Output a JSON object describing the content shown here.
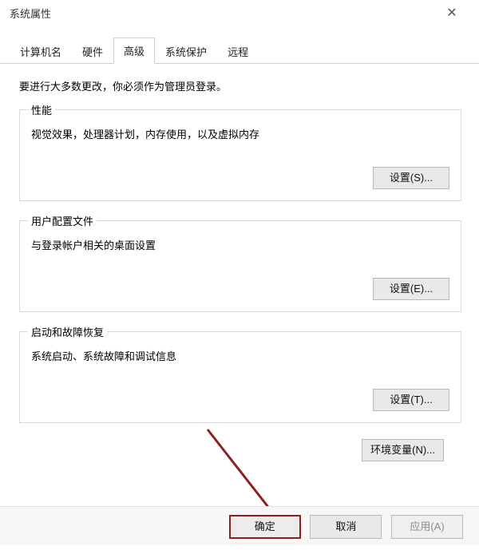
{
  "window": {
    "title": "系统属性"
  },
  "tabs": {
    "computer_name": "计算机名",
    "hardware": "硬件",
    "advanced": "高级",
    "system_protection": "系统保护",
    "remote": "远程"
  },
  "intro": "要进行大多数更改，你必须作为管理员登录。",
  "performance": {
    "legend": "性能",
    "desc": "视觉效果，处理器计划，内存使用，以及虚拟内存",
    "button": "设置(S)..."
  },
  "user_profiles": {
    "legend": "用户配置文件",
    "desc": "与登录帐户相关的桌面设置",
    "button": "设置(E)..."
  },
  "startup": {
    "legend": "启动和故障恢复",
    "desc": "系统启动、系统故障和调试信息",
    "button": "设置(T)..."
  },
  "env_button": "环境变量(N)...",
  "footer": {
    "ok": "确定",
    "cancel": "取消",
    "apply": "应用(A)"
  }
}
